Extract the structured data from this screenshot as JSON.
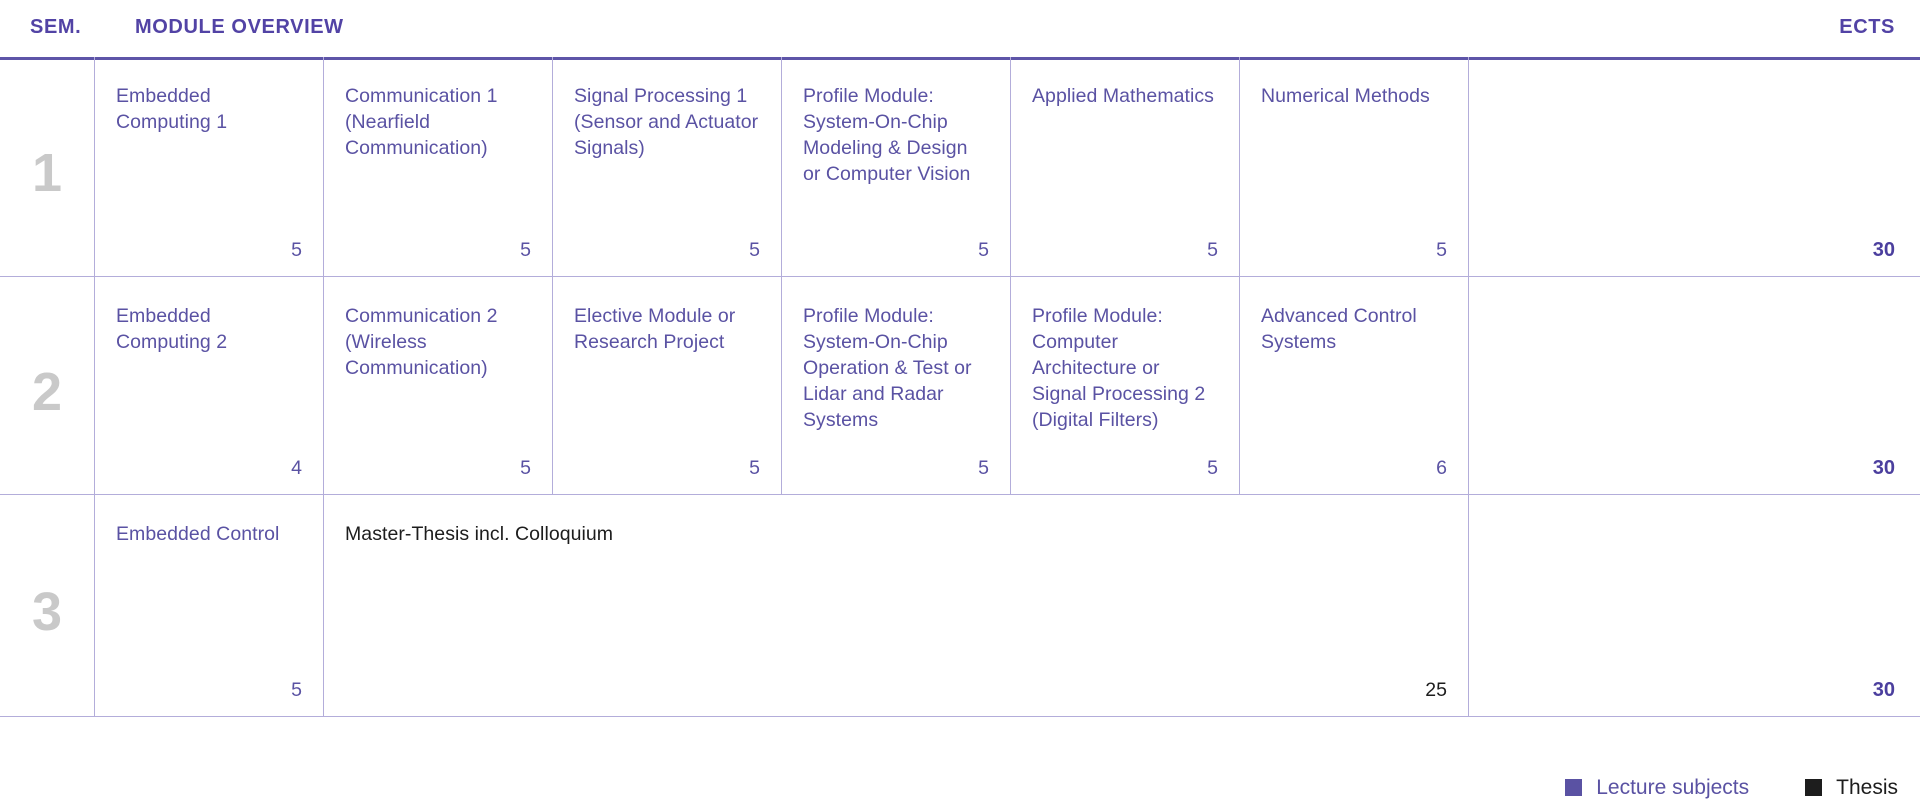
{
  "header": {
    "sem_label": "SEM.",
    "overview_label": "MODULE OVERVIEW",
    "ects_label": "ECTS"
  },
  "colors": {
    "lecture": "#5a52a3",
    "thesis": "#1d1d1d",
    "accent_rule": "#5e55a8",
    "grid": "#b3adda",
    "semester_number": "#c9c9c9",
    "ects_total": "#4b3f9e"
  },
  "rows": [
    {
      "semester": "1",
      "ects_total": "30",
      "cells": [
        {
          "title": "Embedded Computing 1",
          "credits": "5",
          "type": "lecture"
        },
        {
          "title": "Communication 1 (Nearfield Communication)",
          "credits": "5",
          "type": "lecture"
        },
        {
          "title": "Signal Processing 1 (Sensor and Actuator Signals)",
          "credits": "5",
          "type": "lecture"
        },
        {
          "title": "Profile Module: System-On-Chip Modeling & Design or Computer Vision",
          "credits": "5",
          "type": "lecture"
        },
        {
          "title": "Applied Mathematics",
          "credits": "5",
          "type": "lecture"
        },
        {
          "title": "Numerical Methods",
          "credits": "5",
          "type": "lecture"
        }
      ]
    },
    {
      "semester": "2",
      "ects_total": "30",
      "cells": [
        {
          "title": "Embedded Computing 2",
          "credits": "4",
          "type": "lecture"
        },
        {
          "title": "Communication 2 (Wireless Communication)",
          "credits": "5",
          "type": "lecture"
        },
        {
          "title": "Elective Module or Research Project",
          "credits": "5",
          "type": "lecture"
        },
        {
          "title": "Profile Module: System-On-Chip Operation & Test or Lidar and Radar Systems",
          "credits": "5",
          "type": "lecture"
        },
        {
          "title": "Profile Module: Computer Architecture or Signal Processing 2 (Digital Filters)",
          "credits": "5",
          "type": "lecture"
        },
        {
          "title": "Advanced Control Systems",
          "credits": "6",
          "type": "lecture"
        }
      ]
    },
    {
      "semester": "3",
      "ects_total": "30",
      "cells": [
        {
          "title": "Embedded Control",
          "credits": "5",
          "type": "lecture"
        },
        {
          "title": "Master-Thesis incl. Colloquium",
          "credits": "25",
          "type": "thesis"
        }
      ]
    }
  ],
  "legend": [
    {
      "label": "Lecture subjects",
      "color": "#5a52a3"
    },
    {
      "label": "Thesis",
      "color": "#1d1d1d"
    }
  ]
}
